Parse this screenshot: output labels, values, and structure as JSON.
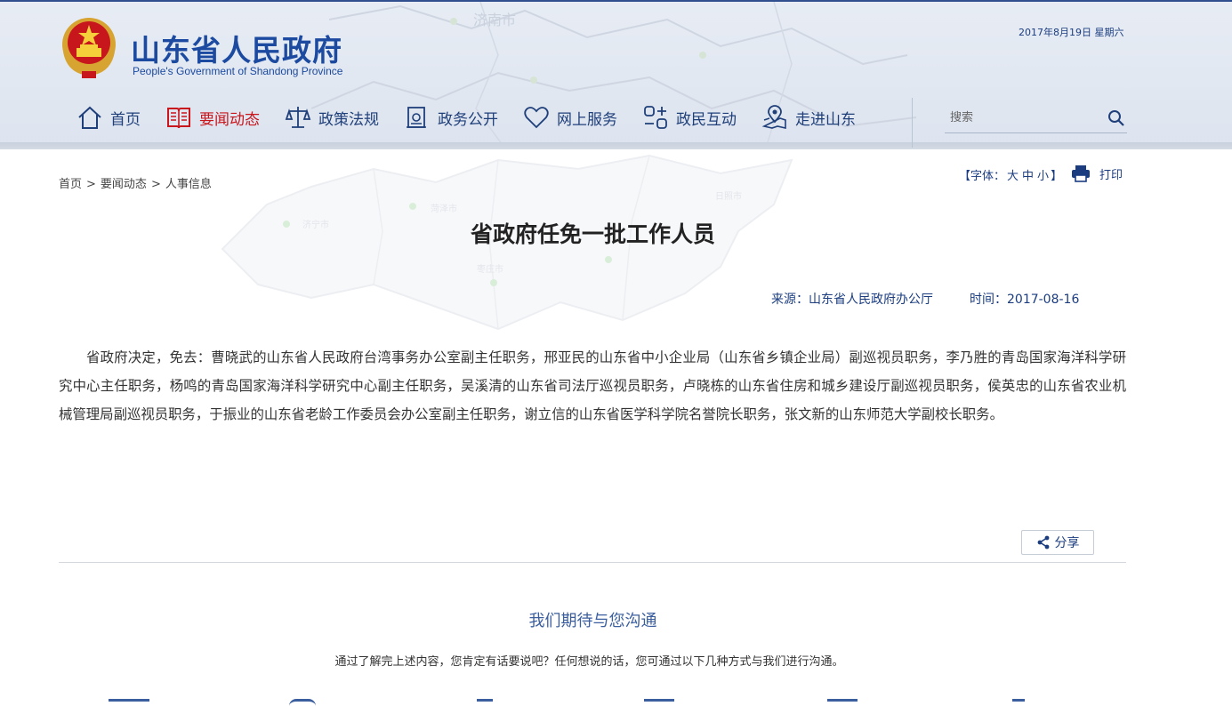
{
  "header": {
    "title": "山东省人民政府",
    "subtitle": "People's Government of Shandong Province",
    "date": "2017年8月19日  星期六",
    "map_labels": [
      "济南市"
    ]
  },
  "nav": {
    "items": [
      {
        "label": "首页",
        "icon": "home-icon"
      },
      {
        "label": "要闻动态",
        "icon": "news-book-icon",
        "active": true
      },
      {
        "label": "政策法规",
        "icon": "scales-icon"
      },
      {
        "label": "政务公开",
        "icon": "document-stamp-icon"
      },
      {
        "label": "网上服务",
        "icon": "heart-icon"
      },
      {
        "label": "政民互动",
        "icon": "interaction-icon"
      },
      {
        "label": "走进山东",
        "icon": "map-pin-icon"
      }
    ],
    "search_placeholder": "搜索"
  },
  "breadcrumb": [
    "首页",
    "要闻动态",
    "人事信息"
  ],
  "breadcrumb_sep": ">",
  "font_size": {
    "prefix": "【字体：",
    "sizes": [
      "大",
      "中",
      "小"
    ],
    "suffix": "】"
  },
  "print_label": "打印",
  "article": {
    "title": "省政府任免一批工作人员",
    "source": "来源：山东省人民政府办公厅",
    "time": "时间：2017-08-16",
    "body": "省政府决定，免去：曹晓武的山东省人民政府台湾事务办公室副主任职务，邢亚民的山东省中小企业局（山东省乡镇企业局）副巡视员职务，李乃胜的青岛国家海洋科学研究中心主任职务，杨鸣的青岛国家海洋科学研究中心副主任职务，吴溪清的山东省司法厅巡视员职务，卢晓栋的山东省住房和城乡建设厅副巡视员职务，侯英忠的山东省农业机械管理局副巡视员职务，于振业的山东省老龄工作委员会办公室副主任职务，谢立信的山东省医学科学院名誉院长职务，张文新的山东师范大学副校长职务。"
  },
  "share_label": "分享",
  "contact": {
    "title": "我们期待与您沟通",
    "description": "通过了解完上述内容，您肯定有话要说吧？任何想说的话，您可通过以下几种方式与我们进行沟通。"
  },
  "watermark_map_labels": [
    "济宁市",
    "菏泽市",
    "枣庄市",
    "日照市"
  ],
  "colors": {
    "brand_blue": "#1b4aa0",
    "nav_blue": "#1f3f7a",
    "active_red": "#c8161d",
    "header_bg": "#e3e9f2"
  }
}
